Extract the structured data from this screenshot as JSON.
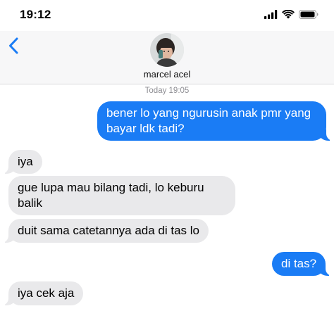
{
  "status_bar": {
    "time": "19:12"
  },
  "header": {
    "contact_name": "marcel acel"
  },
  "conversation": {
    "timestamp": "Today 19:05",
    "messages": [
      {
        "direction": "outgoing",
        "text": "bener lo yang ngurusin anak pmr yang bayar ldk tadi?"
      },
      {
        "direction": "incoming",
        "text": "iya"
      },
      {
        "direction": "incoming",
        "text": "gue lupa mau bilang tadi, lo keburu balik"
      },
      {
        "direction": "incoming",
        "text": "duit sama catetannya ada di tas lo"
      },
      {
        "direction": "outgoing",
        "text": "di tas?"
      },
      {
        "direction": "incoming",
        "text": "iya cek aja"
      }
    ]
  },
  "colors": {
    "outgoing_bubble": "#1a7cf5",
    "incoming_bubble": "#e9e9eb",
    "accent": "#1a7cf5"
  },
  "icons": {
    "back": "chevron-left-icon",
    "signal": "cellular-signal-icon",
    "wifi": "wifi-icon",
    "battery": "battery-icon"
  }
}
